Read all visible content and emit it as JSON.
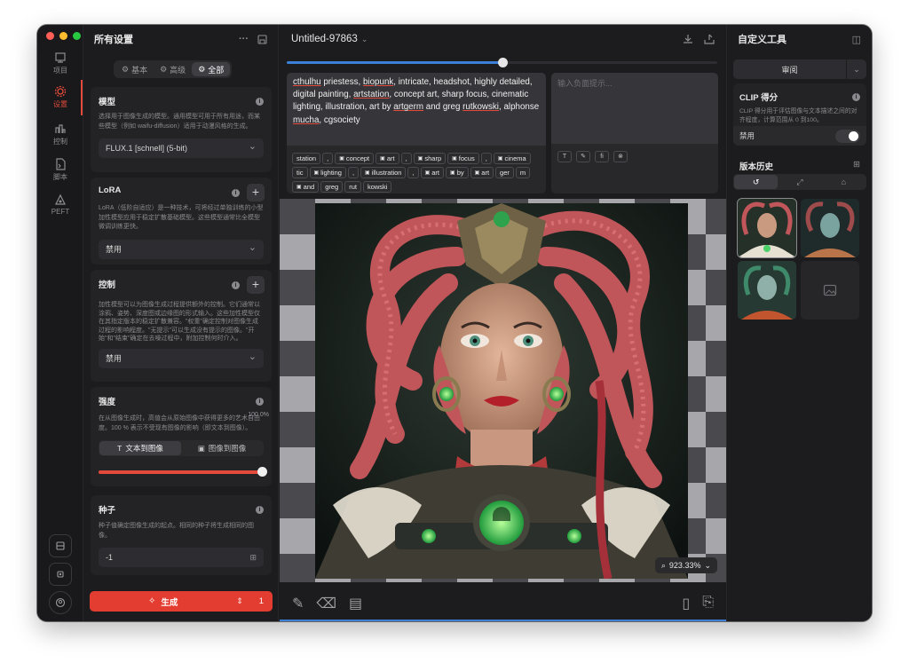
{
  "rail": {
    "items": [
      {
        "label": "项目",
        "icon": "project-icon"
      },
      {
        "label": "设置",
        "icon": "settings-gear-icon",
        "active": true
      },
      {
        "label": "控制",
        "icon": "control-icon"
      },
      {
        "label": "脚本",
        "icon": "script-icon"
      },
      {
        "label": "PEFT",
        "icon": "peft-icon"
      }
    ]
  },
  "settings": {
    "title": "所有设置",
    "tabs": [
      "基本",
      "高级",
      "全部"
    ],
    "active_tab": "全部",
    "model": {
      "title": "模型",
      "desc": "选择用于图像生成的模型。通用模型可用于所有用途，而某些模型（例如 waifu-diffusion）适用于动漫风格的生成。",
      "value": "FLUX.1 [schnell] (5-bit)"
    },
    "lora": {
      "title": "LoRA",
      "desc": "LoRA（低阶自适应）是一种技术，可将经过单独训练的小型加性模型应用于稳定扩散基础模型。这些模型通常比全模型微调训练更快。",
      "value": "禁用"
    },
    "control": {
      "title": "控制",
      "desc": "加性模型可以为图像生成过程提供额外的控制。它们通常以涂鸦、姿势、深度图或边缘图的形式输入。这些加性模型仅在其指定版本的稳定扩散兼容。\"权重\"确定控制对图像生成过程的影响程度。\"无提示\"可以生成没有提示的图像。\"开始\"和\"结束\"确定在去噪过程中，附加控制何时介入。",
      "value": "禁用"
    },
    "strength": {
      "title": "强度",
      "desc": "在从图像生成时，高值会从原始图像中获得更多的艺术自由度。100 % 表示不受现有图像的影响（即文本到图像）。",
      "mode_text": "文本到图像",
      "mode_image": "图像到图像",
      "value_label": "100.0%",
      "value": 1.0
    },
    "seed": {
      "title": "种子",
      "desc": "种子值确定图像生成的起点。相同的种子将生成相同的图像。",
      "value": "-1"
    },
    "generate": {
      "label": "生成",
      "count": "1"
    }
  },
  "center": {
    "title": "Untitled-97863",
    "progress": 0.5,
    "prompt_parts": [
      {
        "t": "cthulhu",
        "u": true
      },
      {
        "t": " priestess, "
      },
      {
        "t": "biopunk",
        "u": true
      },
      {
        "t": ", intricate, headshot, highly detailed, digital painting, "
      },
      {
        "t": "artstation",
        "u": true
      },
      {
        "t": ", concept art, sharp focus, cinematic lighting, illustration, art by "
      },
      {
        "t": "artgerm",
        "u": true
      },
      {
        "t": " and greg "
      },
      {
        "t": "rutkowski",
        "u": true
      },
      {
        "t": ", alphonse "
      },
      {
        "t": "mucha",
        "u": true
      },
      {
        "t": ", cgsociety"
      }
    ],
    "tags": [
      {
        "t": "station"
      },
      {
        "t": ","
      },
      {
        "t": "concept",
        "i": true
      },
      {
        "t": "art",
        "i": true
      },
      {
        "t": ","
      },
      {
        "t": "sharp",
        "i": true
      },
      {
        "t": "focus",
        "i": true
      },
      {
        "t": ","
      },
      {
        "t": "cinema",
        "i": true
      },
      {
        "t": "tic"
      },
      {
        "t": "lighting",
        "i": true
      },
      {
        "t": ","
      },
      {
        "t": "illustration",
        "i": true
      },
      {
        "t": ","
      },
      {
        "t": "art",
        "i": true
      },
      {
        "t": "by",
        "i": true
      },
      {
        "t": "art",
        "i": true
      },
      {
        "t": "ger"
      },
      {
        "t": "m"
      },
      {
        "t": "and",
        "i": true
      },
      {
        "t": "greg"
      },
      {
        "t": "rut"
      },
      {
        "t": "kowski"
      }
    ],
    "negative_placeholder": "输入负面提示...",
    "negative_icons": [
      "T",
      "✎",
      "fi",
      "⊗"
    ],
    "zoom": "923.33%"
  },
  "right": {
    "title": "自定义工具",
    "review": "审阅",
    "clip": {
      "title": "CLIP 得分",
      "desc": "CLIP 得分用于评估图像与文本描述之间的对齐程度，计算范围从 0 到100。",
      "state": "禁用"
    },
    "history_title": "版本历史"
  },
  "colors": {
    "accent": "#e34a3c",
    "blue": "#3b7fd6",
    "bg": "#1c1c1e"
  }
}
